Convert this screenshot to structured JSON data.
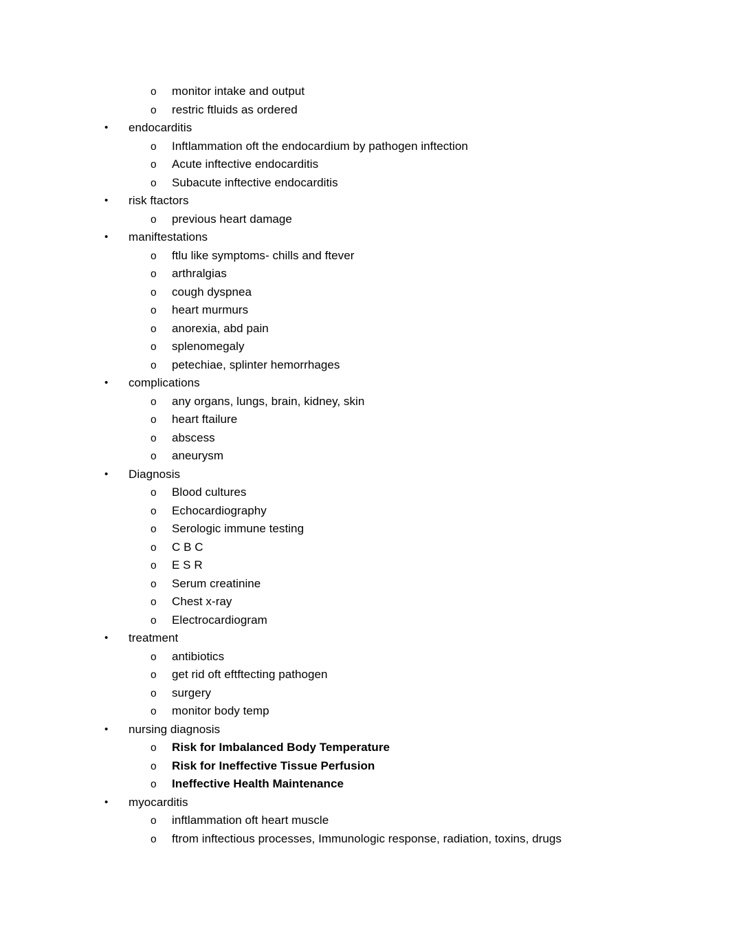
{
  "document": {
    "page_background": "#ffffff",
    "text_color": "#000000",
    "outline": [
      {
        "level": 2,
        "marker": "o",
        "bold": false,
        "text": "monitor intake and output"
      },
      {
        "level": 2,
        "marker": "o",
        "bold": false,
        "text": "restric ftluids as ordered"
      },
      {
        "level": 1,
        "marker": "•",
        "bold": false,
        "text": "endocarditis"
      },
      {
        "level": 2,
        "marker": "o",
        "bold": false,
        "text": "Inftlammation oft the endocardium by pathogen inftection"
      },
      {
        "level": 2,
        "marker": "o",
        "bold": false,
        "text": "Acute inftective endocarditis"
      },
      {
        "level": 2,
        "marker": "o",
        "bold": false,
        "text": "Subacute inftective endocarditis"
      },
      {
        "level": 1,
        "marker": "•",
        "bold": false,
        "text": "risk ftactors"
      },
      {
        "level": 2,
        "marker": "o",
        "bold": false,
        "text": "previous heart damage"
      },
      {
        "level": 1,
        "marker": "•",
        "bold": false,
        "text": "maniftestations"
      },
      {
        "level": 2,
        "marker": "o",
        "bold": false,
        "text": "ftlu like symptoms- chills and ftever"
      },
      {
        "level": 2,
        "marker": "o",
        "bold": false,
        "text": "arthralgias"
      },
      {
        "level": 2,
        "marker": "o",
        "bold": false,
        "text": "cough dyspnea"
      },
      {
        "level": 2,
        "marker": "o",
        "bold": false,
        "text": "heart murmurs"
      },
      {
        "level": 2,
        "marker": "o",
        "bold": false,
        "text": "anorexia, abd pain"
      },
      {
        "level": 2,
        "marker": "o",
        "bold": false,
        "text": "splenomegaly"
      },
      {
        "level": 2,
        "marker": "o",
        "bold": false,
        "text": "petechiae, splinter hemorrhages"
      },
      {
        "level": 1,
        "marker": "•",
        "bold": false,
        "text": "complications"
      },
      {
        "level": 2,
        "marker": "o",
        "bold": false,
        "text": "any organs, lungs, brain, kidney, skin"
      },
      {
        "level": 2,
        "marker": "o",
        "bold": false,
        "text": "heart ftailure"
      },
      {
        "level": 2,
        "marker": "o",
        "bold": false,
        "text": "abscess"
      },
      {
        "level": 2,
        "marker": "o",
        "bold": false,
        "text": "aneurysm"
      },
      {
        "level": 1,
        "marker": "•",
        "bold": false,
        "text": "Diagnosis"
      },
      {
        "level": 2,
        "marker": "o",
        "bold": false,
        "text": "Blood cultures"
      },
      {
        "level": 2,
        "marker": "o",
        "bold": false,
        "text": "Echocardiography"
      },
      {
        "level": 2,
        "marker": "o",
        "bold": false,
        "text": "Serologic immune testing"
      },
      {
        "level": 2,
        "marker": "o",
        "bold": false,
        "text": "C B C"
      },
      {
        "level": 2,
        "marker": "o",
        "bold": false,
        "text": "E S R"
      },
      {
        "level": 2,
        "marker": "o",
        "bold": false,
        "text": "Serum creatinine"
      },
      {
        "level": 2,
        "marker": "o",
        "bold": false,
        "text": "Chest x-ray"
      },
      {
        "level": 2,
        "marker": "o",
        "bold": false,
        "text": "Electrocardiogram"
      },
      {
        "level": 1,
        "marker": "•",
        "bold": false,
        "text": "treatment"
      },
      {
        "level": 2,
        "marker": "o",
        "bold": false,
        "text": "antibiotics"
      },
      {
        "level": 2,
        "marker": "o",
        "bold": false,
        "text": "get rid oft eftftecting pathogen"
      },
      {
        "level": 2,
        "marker": "o",
        "bold": false,
        "text": "surgery"
      },
      {
        "level": 2,
        "marker": "o",
        "bold": false,
        "text": "monitor body temp"
      },
      {
        "level": 1,
        "marker": "•",
        "bold": false,
        "text": "nursing diagnosis"
      },
      {
        "level": 2,
        "marker": "o",
        "bold": true,
        "text": "Risk for Imbalanced Body Temperature"
      },
      {
        "level": 2,
        "marker": "o",
        "bold": true,
        "text": "Risk for Ineffective Tissue Perfusion"
      },
      {
        "level": 2,
        "marker": "o",
        "bold": true,
        "text": "Ineffective Health Maintenance"
      },
      {
        "level": 1,
        "marker": "•",
        "bold": false,
        "text": "myocarditis"
      },
      {
        "level": 2,
        "marker": "o",
        "bold": false,
        "text": "inftlammation oft heart muscle"
      },
      {
        "level": 2,
        "marker": "o",
        "bold": false,
        "text": "ftrom inftectious processes, Immunologic response, radiation, toxins, drugs"
      }
    ]
  }
}
